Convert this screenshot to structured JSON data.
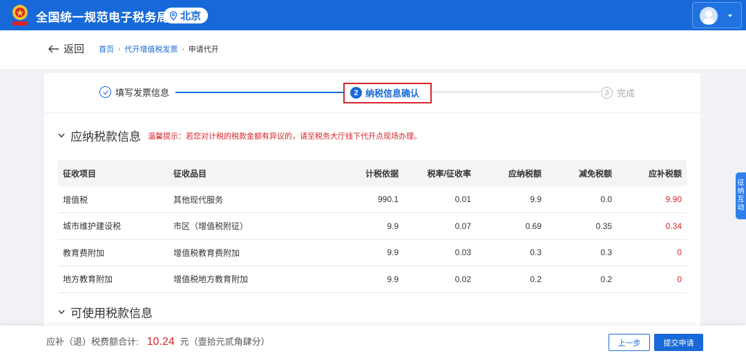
{
  "header": {
    "site_title": "全国统一规范电子税务局",
    "region": "北京",
    "colors": {
      "brand": "#1769d9",
      "alert_red": "#d8232a"
    }
  },
  "nav": {
    "back_label": "返回",
    "breadcrumbs": [
      "首页",
      "代开增值税发票",
      "申请代开"
    ]
  },
  "steps": [
    {
      "label": "填写发票信息",
      "status": "done"
    },
    {
      "num": "2",
      "label": "纳税信息确认",
      "status": "active"
    },
    {
      "num": "3",
      "label": "完成",
      "status": "pending"
    }
  ],
  "tax_section": {
    "title": "应纳税款信息",
    "tip": "温馨提示：若您对计税的税款金额有异议的，请至税务大厅线下代开点现场办理。",
    "columns": [
      "征收项目",
      "征收品目",
      "计税依据",
      "税率/征收率",
      "应纳税额",
      "减免税额",
      "应补税额"
    ],
    "rows": [
      [
        "增值税",
        "其他现代服务",
        "990.1",
        "0.01",
        "9.9",
        "0.0",
        "9.90"
      ],
      [
        "城市维护建设税",
        "市区（增值税附征）",
        "9.9",
        "0.07",
        "0.69",
        "0.35",
        "0.34"
      ],
      [
        "教育费附加",
        "增值税教育费附加",
        "9.9",
        "0.03",
        "0.3",
        "0.3",
        "0"
      ],
      [
        "地方教育附加",
        "增值税地方教育附加",
        "9.9",
        "0.02",
        "0.2",
        "0.2",
        "0"
      ]
    ]
  },
  "usable_section": {
    "title": "可使用税款信息"
  },
  "side_tab": {
    "chars": [
      "征",
      "纳",
      "互",
      "动"
    ]
  },
  "footer": {
    "total_label": "应补（退）税费额合计:",
    "total_amount": "10.24",
    "total_unit": "元（壹拾元贰角肆分）",
    "prev_button": "上一步",
    "submit_button": "提交申请"
  }
}
